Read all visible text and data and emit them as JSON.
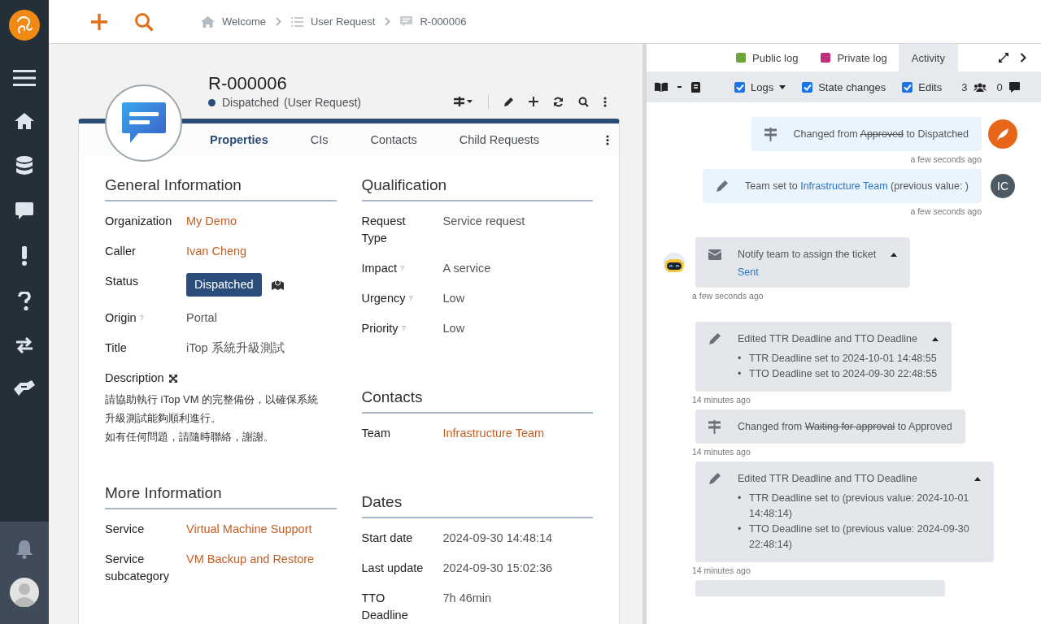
{
  "top_bar": {
    "breadcrumbs": [
      {
        "kind": "home",
        "label": "Welcome"
      },
      {
        "kind": "list",
        "label": "User Request"
      },
      {
        "kind": "ticket",
        "label": "R-000006"
      }
    ]
  },
  "object": {
    "ref": "R-000006",
    "status": "Dispatched",
    "class": "(User Request)",
    "tabs": [
      {
        "label": "Properties",
        "selected": true
      },
      {
        "label": "CIs",
        "selected": false
      },
      {
        "label": "Contacts",
        "selected": false
      },
      {
        "label": "Child Requests",
        "selected": false
      }
    ]
  },
  "columns": [
    [
      {
        "title": "General Information",
        "fields": [
          {
            "label": "Organization",
            "kind": "link",
            "value": "My Demo"
          },
          {
            "label": "Caller",
            "kind": "link",
            "value": "Ivan Cheng"
          },
          {
            "label": "Status",
            "kind": "badge",
            "value": "Dispatched"
          },
          {
            "label": "Origin",
            "hint": "?",
            "kind": "text",
            "value": "Portal"
          },
          {
            "label": "Title",
            "kind": "text",
            "value": "iTop 系統升級測試"
          },
          {
            "label": "Description",
            "kind": "longtext",
            "paragraphs": [
              "請協助執行 iTop VM 的完整備份，以確保系統升級測試能夠順利進行。",
              "如有任何問題，請隨時聯絡，謝謝。"
            ]
          }
        ]
      },
      {
        "title": "More Information",
        "fields": [
          {
            "label": "Service",
            "kind": "link",
            "value": "Virtual Machine Support"
          },
          {
            "label": "Service subcategory",
            "kind": "link",
            "value": "VM Backup and Restore"
          }
        ]
      }
    ],
    [
      {
        "title": "Qualification",
        "fields": [
          {
            "label": "Request Type",
            "kind": "text",
            "value": "Service request"
          },
          {
            "label": "Impact",
            "hint": "?",
            "kind": "text",
            "value": "A service"
          },
          {
            "label": "Urgency",
            "hint": "?",
            "kind": "text",
            "value": "Low"
          },
          {
            "label": "Priority",
            "hint": "?",
            "kind": "text",
            "value": "Low"
          }
        ]
      },
      {
        "title": "Contacts",
        "fields": [
          {
            "label": "Team",
            "kind": "link",
            "value": "Infrastructure Team"
          }
        ]
      },
      {
        "title": "Dates",
        "fields": [
          {
            "label": "Start date",
            "kind": "text",
            "value": "2024-09-30 14:48:14"
          },
          {
            "label": "Last update",
            "kind": "text",
            "value": "2024-09-30 15:02:36"
          },
          {
            "label": "TTO Deadline",
            "kind": "text",
            "value": "7h 46min"
          }
        ]
      }
    ]
  ],
  "activity_panel": {
    "tabs": [
      {
        "label": "Public log",
        "color": "#6aa63a",
        "selected": false
      },
      {
        "label": "Private log",
        "color": "#c0307a",
        "selected": false
      },
      {
        "label": "Activity",
        "selected": true
      }
    ],
    "filters": [
      {
        "label": "Logs",
        "checked": true,
        "dropdown": true
      },
      {
        "label": "State changes",
        "checked": true,
        "dropdown": false
      },
      {
        "label": "Edits",
        "checked": true,
        "dropdown": false
      }
    ],
    "participants": "3",
    "messages": "0",
    "entries": [
      {
        "kind": "state",
        "mine": true,
        "avatar": {
          "kind": "feather"
        },
        "before": "Changed from",
        "old": "Approved",
        "after": "to Dispatched",
        "time": "a few seconds ago"
      },
      {
        "kind": "edit",
        "mine": true,
        "avatar": {
          "kind": "initials",
          "initials": "IC"
        },
        "before": "Team set to",
        "link": "Infrastructure Team",
        "after": "(previous value: )",
        "time": "a few seconds ago"
      },
      {
        "kind": "notify",
        "mine": false,
        "avatar": {
          "kind": "robot"
        },
        "text": "Notify team to assign the ticket",
        "status": "Sent",
        "expanded": true,
        "time": "a few seconds ago"
      },
      {
        "kind": "edits",
        "mine": false,
        "text": "Edited TTR Deadline and TTO Deadline",
        "expanded": true,
        "items": [
          {
            "marker": "•",
            "text": "TTR Deadline set to 2024-10-01 14:48:55"
          },
          {
            "marker": "•",
            "text": "TTO Deadline set to 2024-09-30 22:48:55"
          }
        ],
        "time": "14 minutes ago"
      },
      {
        "kind": "state",
        "mine": false,
        "before": "Changed from",
        "old": "Waiting for approval",
        "after": "to Approved",
        "time": "14 minutes ago"
      },
      {
        "kind": "edits",
        "mine": false,
        "text": "Edited TTR Deadline and TTO Deadline",
        "expanded": true,
        "items": [
          {
            "marker": "•",
            "text": "TTR Deadline set to (previous value: 2024-10-01 14:48:14)"
          },
          {
            "marker": "•",
            "text": "TTO Deadline set to (previous value: 2024-09-30 22:48:14)"
          }
        ],
        "time": "14 minutes ago"
      },
      {
        "kind": "truncated",
        "mine": false
      }
    ]
  }
}
